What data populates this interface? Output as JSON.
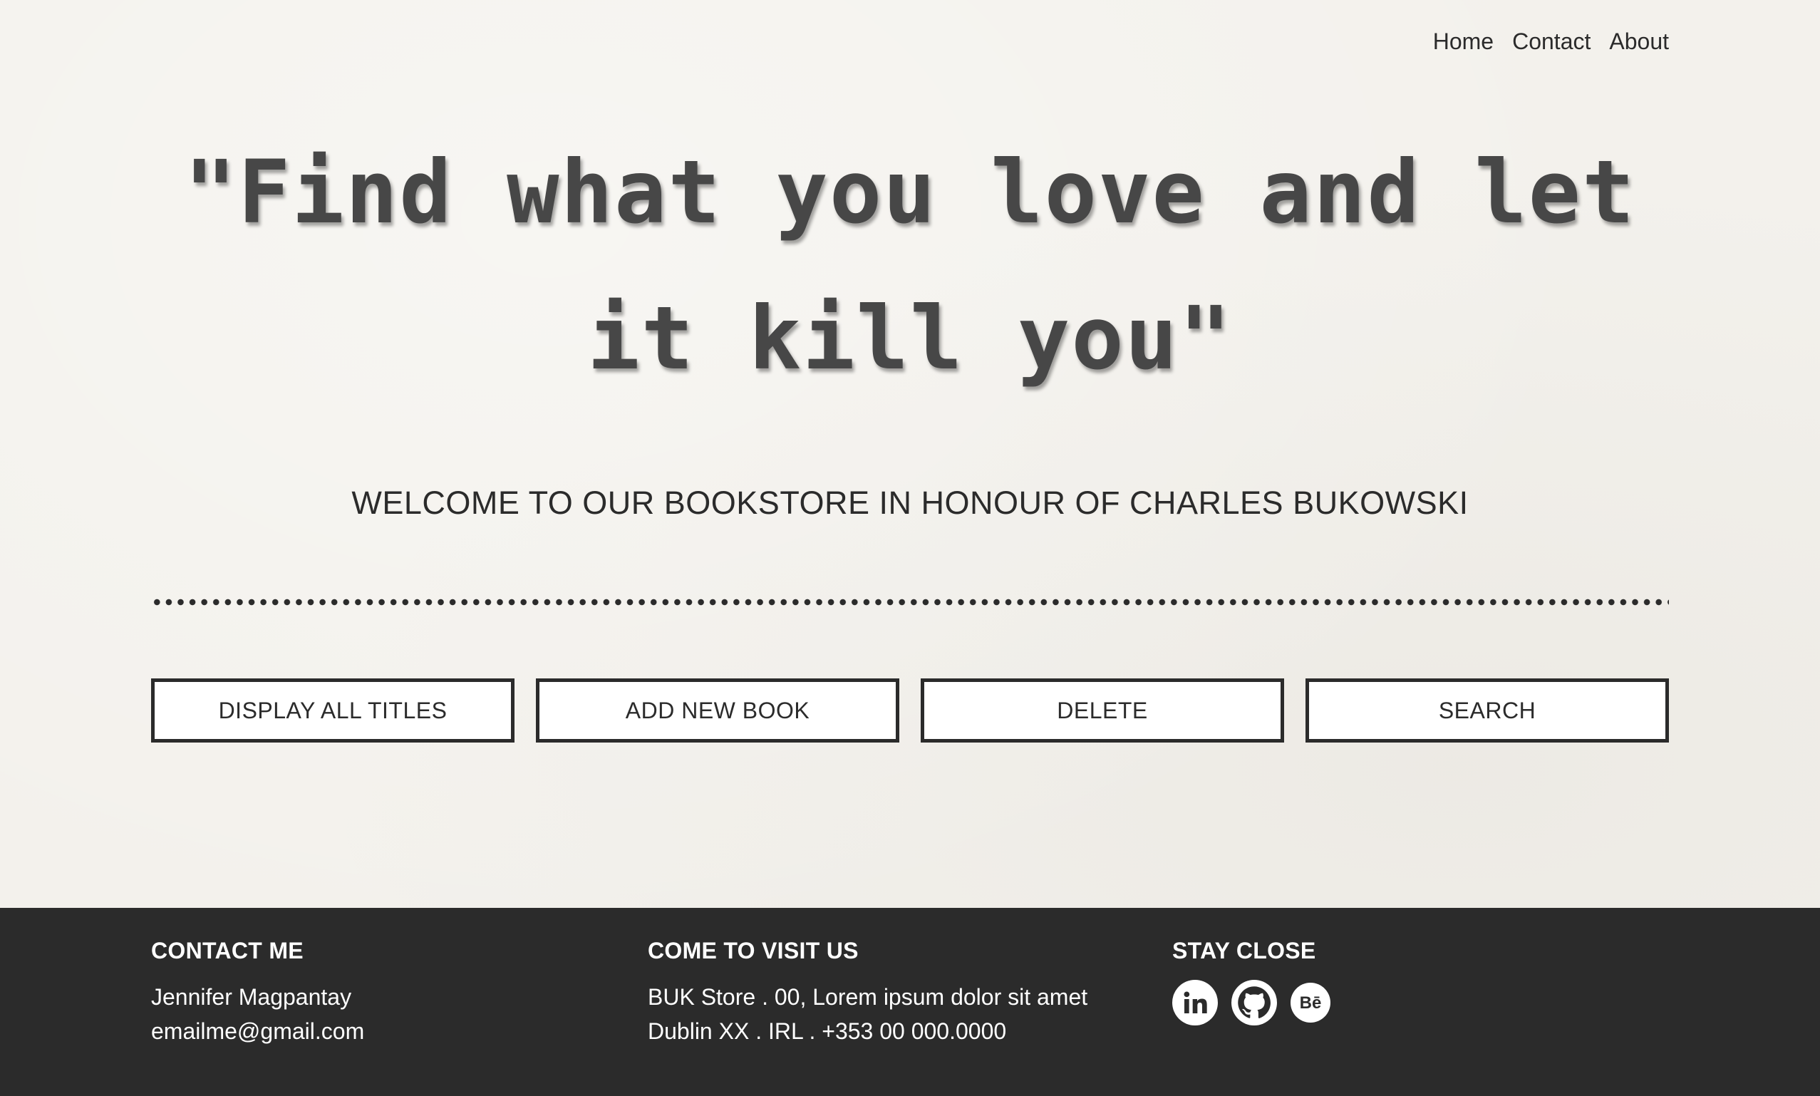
{
  "nav": {
    "items": [
      {
        "label": "Home"
      },
      {
        "label": "Contact"
      },
      {
        "label": "About"
      }
    ]
  },
  "hero": {
    "quote_line_1": "\"Find what you love and let",
    "quote_line_2": "it kill you\"",
    "welcome": "WELCOME TO OUR BOOKSTORE IN HONOUR OF CHARLES BUKOWSKI"
  },
  "actions": {
    "display_all": "DISPLAY ALL TITLES",
    "add_new": "ADD NEW BOOK",
    "delete": "DELETE",
    "search": "SEARCH"
  },
  "footer": {
    "contact": {
      "heading": "CONTACT ME",
      "name": "Jennifer Magpantay",
      "email": "emailme@gmail.com"
    },
    "visit": {
      "heading": "COME TO VISIT US",
      "line_1": "BUK Store . 00, Lorem ipsum dolor sit amet",
      "line_2": "Dublin XX . IRL . +353 00 000.0000"
    },
    "social": {
      "heading": "STAY CLOSE",
      "icons": [
        "linkedin-icon",
        "github-icon",
        "behance-icon"
      ],
      "behance_text": "Bē"
    }
  },
  "colors": {
    "background": "#f3f1ec",
    "text": "#2b2b2b",
    "footer_bg": "#2b2b2b",
    "quote": "#474747",
    "button_bg": "#ffffff"
  }
}
